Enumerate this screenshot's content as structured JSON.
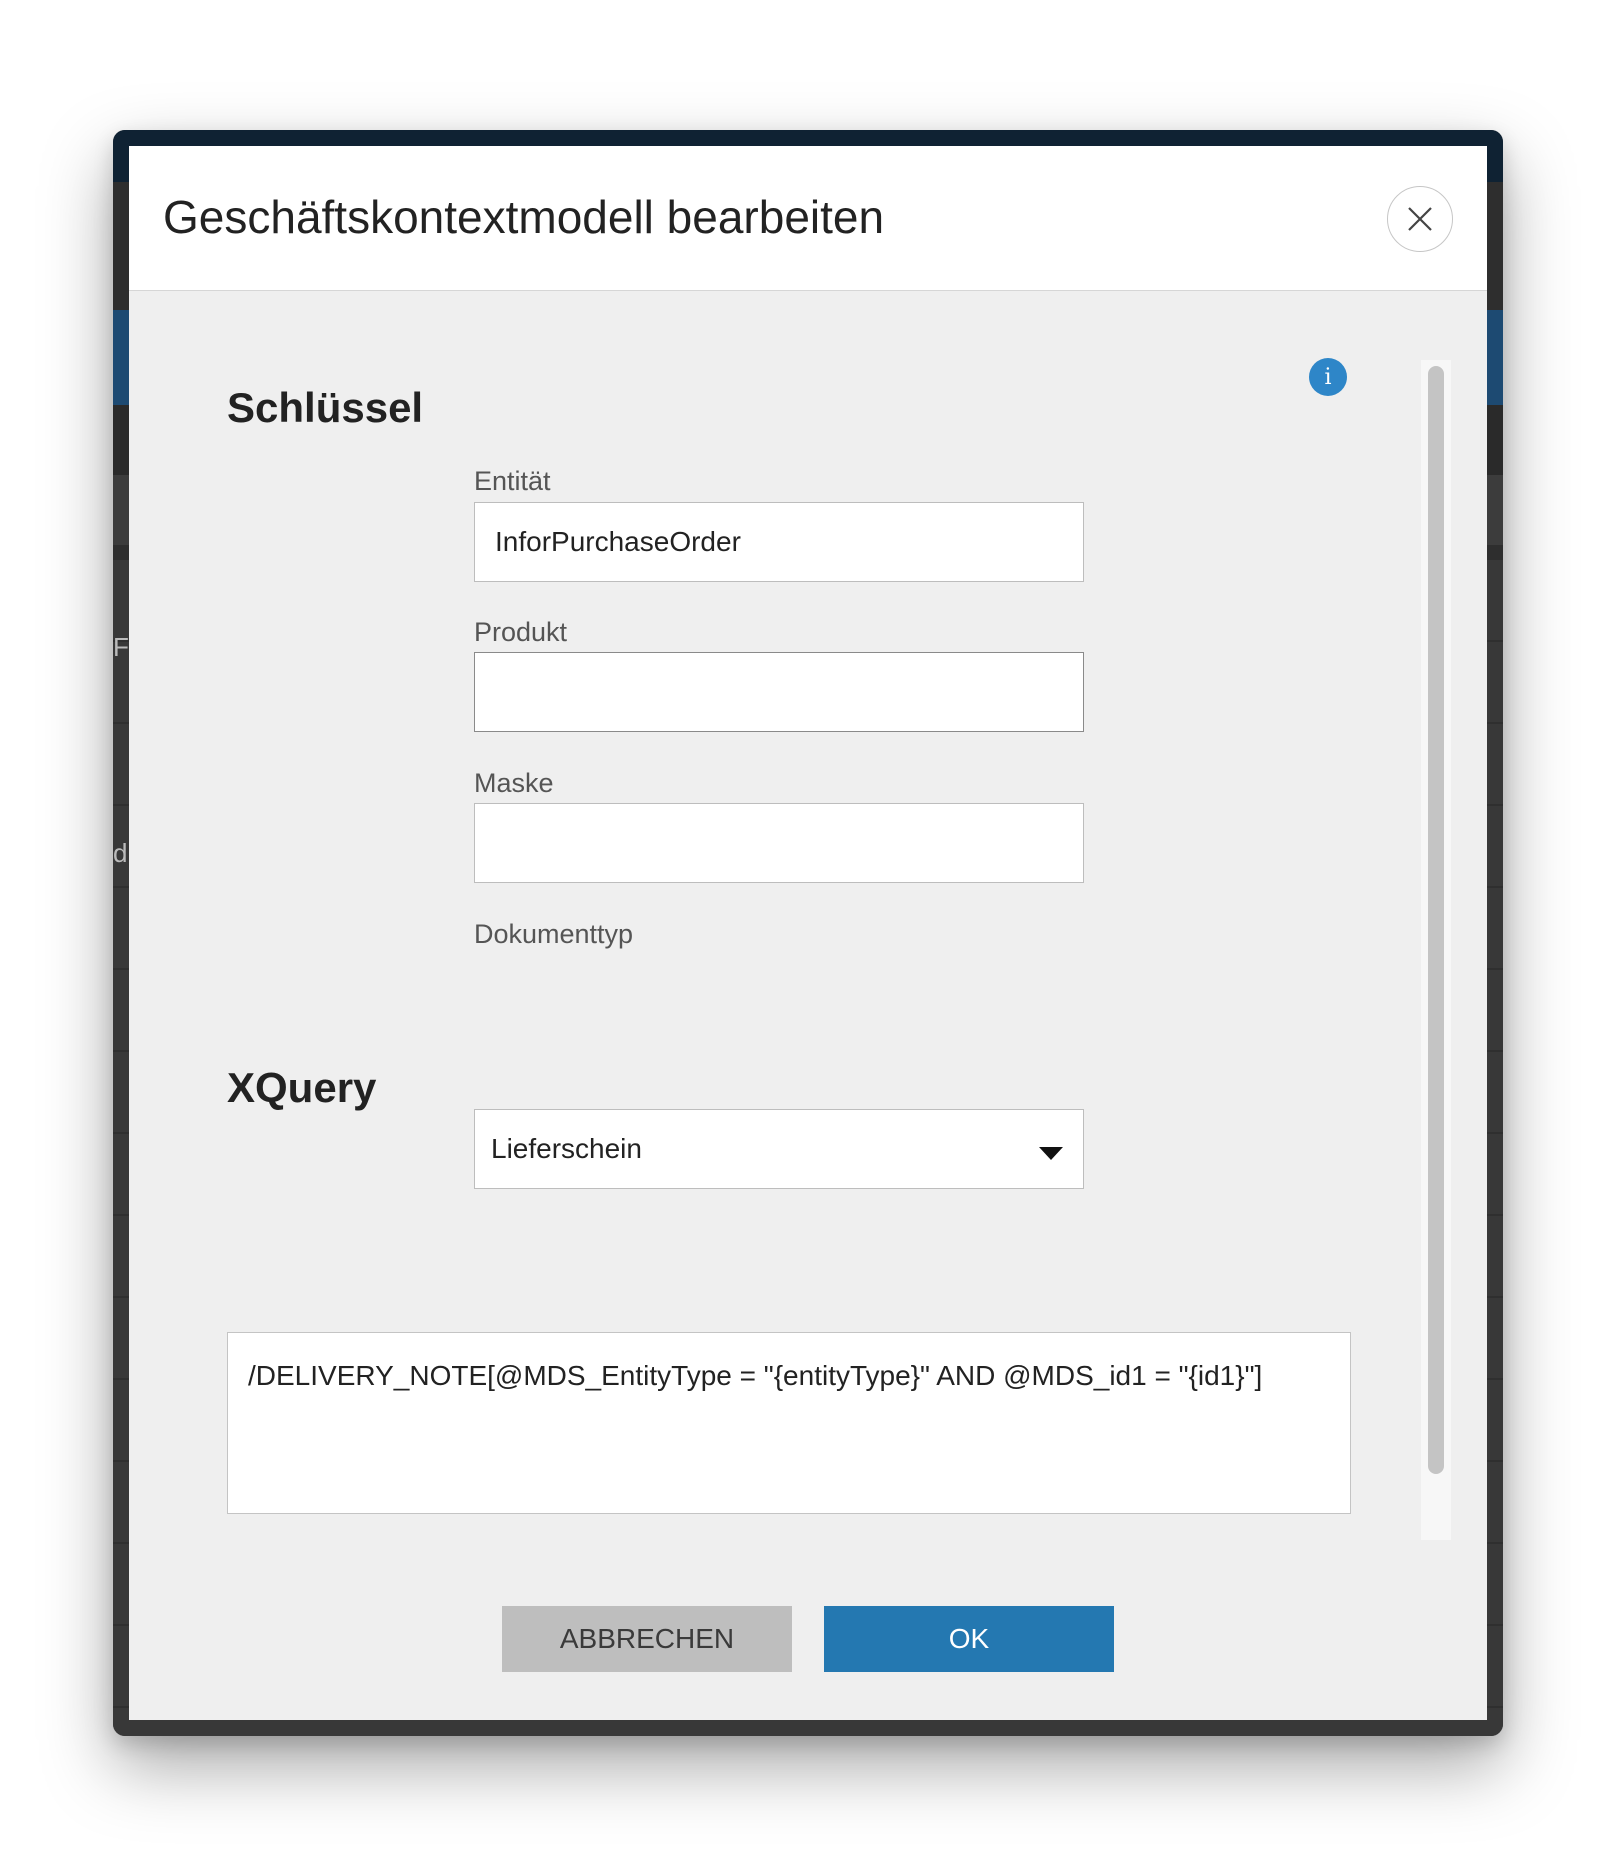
{
  "dialog": {
    "title": "Geschäftskontextmodell bearbeiten",
    "close_icon": "close-icon",
    "info_icon": "info-icon",
    "info_glyph": "i"
  },
  "sections": {
    "key_title": "Schlüssel",
    "xquery_title": "XQuery"
  },
  "fields": {
    "entity": {
      "label": "Entität",
      "value": "InforPurchaseOrder"
    },
    "product": {
      "label": "Produkt",
      "value": ""
    },
    "mask": {
      "label": "Maske",
      "value": ""
    },
    "doctype": {
      "label": "Dokumenttyp",
      "value": "Lieferschein"
    }
  },
  "xquery": {
    "value": "/DELIVERY_NOTE[@MDS_EntityType = \"{entityType}\" AND @MDS_id1 = \"{id1}\"]"
  },
  "buttons": {
    "cancel_label": "ABBRECHEN",
    "ok_label": "OK"
  },
  "background": {
    "peek_1": "Fi",
    "peek_2": "d"
  },
  "colors": {
    "accent": "#2478b1",
    "info": "#2e86c8",
    "dialog_bg": "#efefef",
    "cancel_bg": "#bebebe"
  }
}
